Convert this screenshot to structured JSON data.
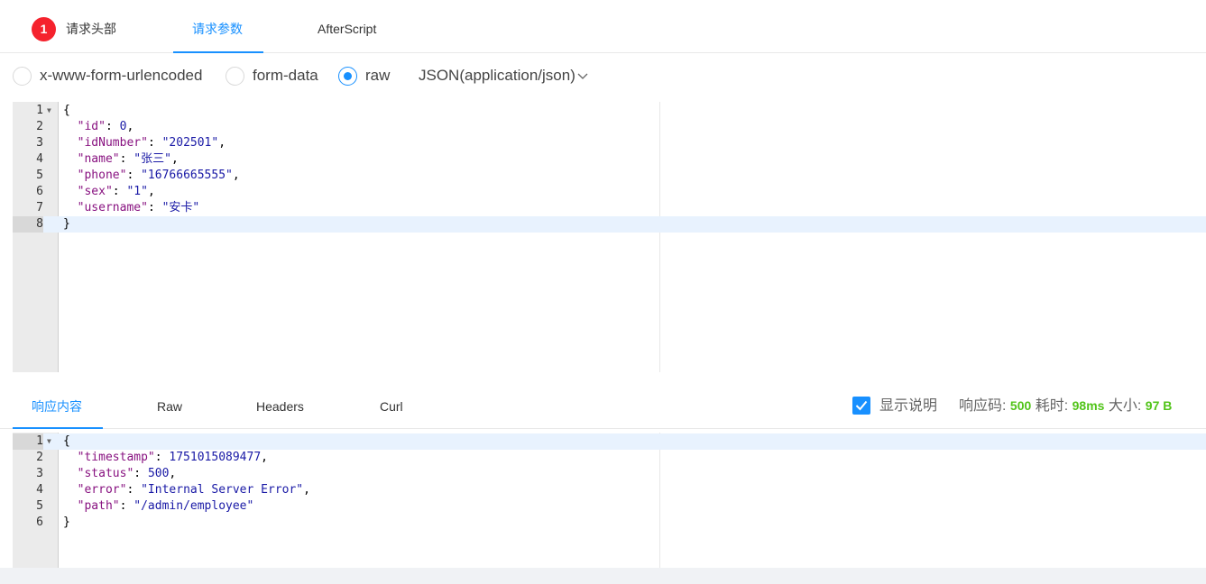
{
  "top_tabs": {
    "badge_count": "1",
    "headers_label": "请求头部",
    "params_label": "请求参数",
    "afterscript_label": "AfterScript"
  },
  "body_types": {
    "urlencoded_label": "x-www-form-urlencoded",
    "formdata_label": "form-data",
    "raw_label": "raw",
    "selected": "raw",
    "content_type": "JSON(application/json)"
  },
  "request_editor": {
    "lines": [
      {
        "num": "1",
        "fold": true,
        "text": "{"
      },
      {
        "num": "2",
        "key": "\"id\"",
        "sep": ": ",
        "val": "0",
        "val_type": "n",
        "tail": ","
      },
      {
        "num": "3",
        "key": "\"idNumber\"",
        "sep": ": ",
        "val": "\"202501\"",
        "val_type": "s",
        "tail": ","
      },
      {
        "num": "4",
        "key": "\"name\"",
        "sep": ": ",
        "val": "\"张三\"",
        "val_type": "s",
        "tail": ","
      },
      {
        "num": "5",
        "key": "\"phone\"",
        "sep": ": ",
        "val": "\"16766665555\"",
        "val_type": "s",
        "tail": ","
      },
      {
        "num": "6",
        "key": "\"sex\"",
        "sep": ": ",
        "val": "\"1\"",
        "val_type": "s",
        "tail": ","
      },
      {
        "num": "7",
        "key": "\"username\"",
        "sep": ": ",
        "val": "\"安卡\"",
        "val_type": "s",
        "tail": ""
      },
      {
        "num": "8",
        "text": "}",
        "active": true
      }
    ]
  },
  "response_tabs": {
    "content_label": "响应内容",
    "raw_label": "Raw",
    "headers_label": "Headers",
    "curl_label": "Curl",
    "show_desc_label": "显示说明",
    "status_label": "响应码:",
    "status_value": "500",
    "time_label": "耗时:",
    "time_value": "98ms",
    "size_label": "大小:",
    "size_value": "97 B"
  },
  "response_editor": {
    "lines": [
      {
        "num": "1",
        "fold": true,
        "text": "{",
        "active": true
      },
      {
        "num": "2",
        "key": "\"timestamp\"",
        "sep": ": ",
        "val": "1751015089477",
        "val_type": "n",
        "tail": ","
      },
      {
        "num": "3",
        "key": "\"status\"",
        "sep": ": ",
        "val": "500",
        "val_type": "n",
        "tail": ","
      },
      {
        "num": "4",
        "key": "\"error\"",
        "sep": ": ",
        "val": "\"Internal Server Error\"",
        "val_type": "s",
        "tail": ","
      },
      {
        "num": "5",
        "key": "\"path\"",
        "sep": ": ",
        "val": "\"/admin/employee\"",
        "val_type": "s",
        "tail": ""
      },
      {
        "num": "6",
        "text": "}"
      }
    ]
  }
}
